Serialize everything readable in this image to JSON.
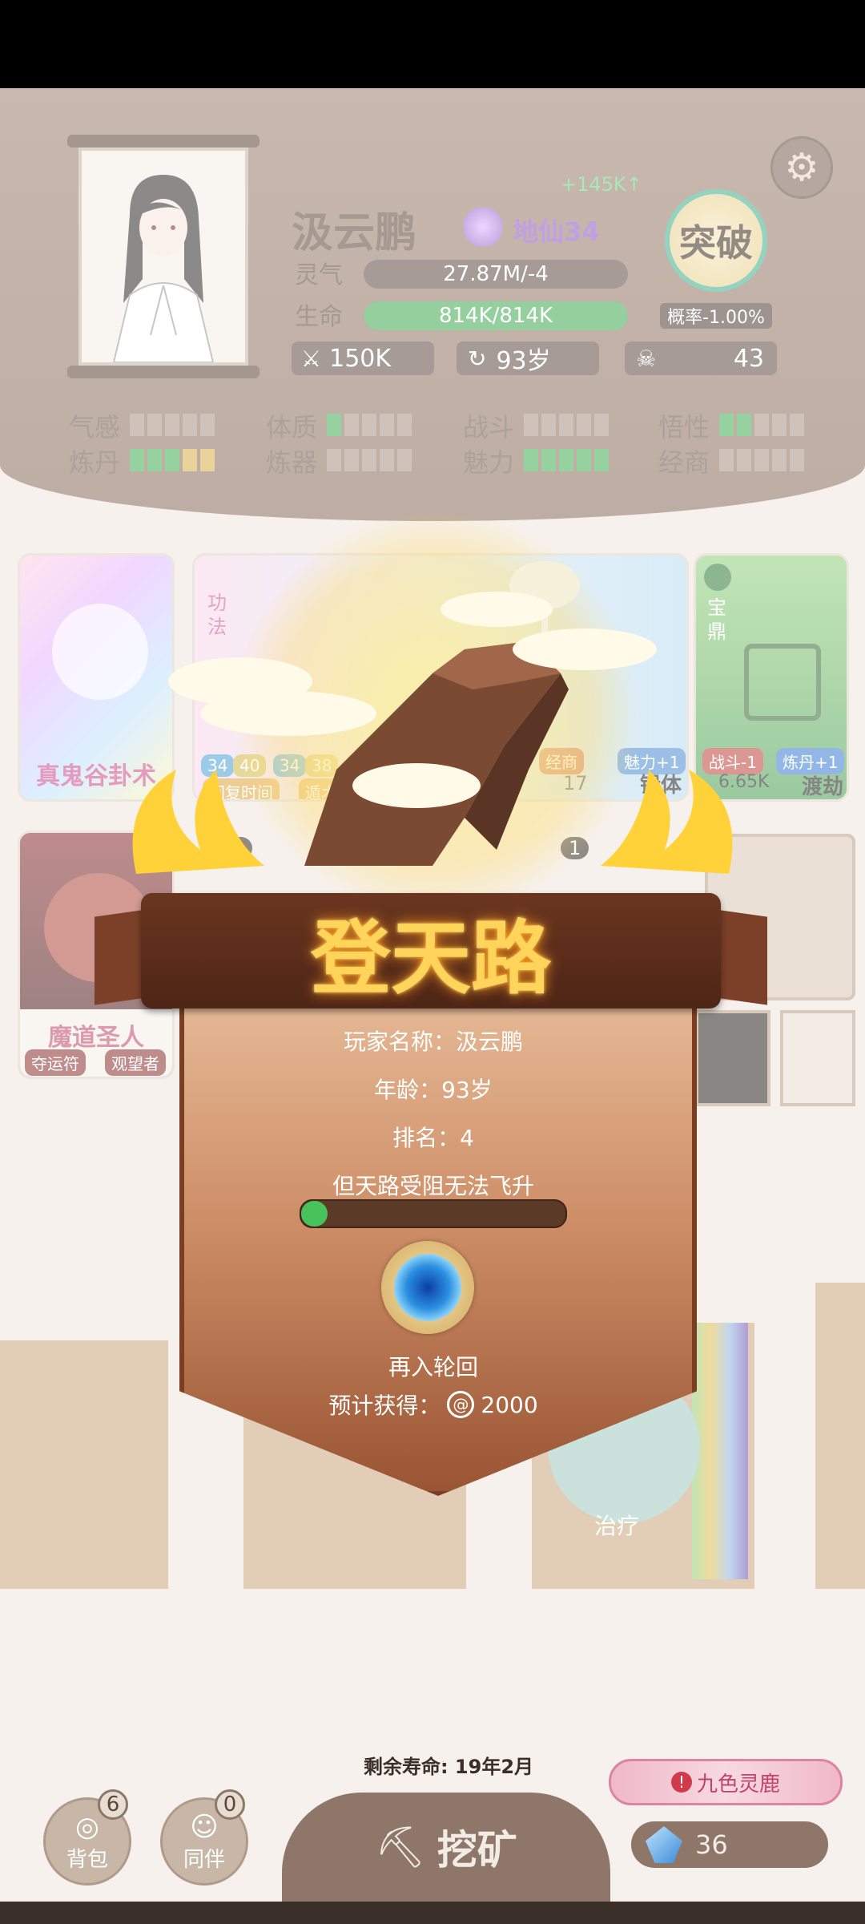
{
  "player": {
    "name": "汲云鹏",
    "realm": "地仙34",
    "exp_gain": "+145K",
    "lingqi_label": "灵气",
    "lingqi_value": "27.87M/-4",
    "hp_label": "生命",
    "hp_value": "814K/814K",
    "hp_ratio": 1.0,
    "power": "150K",
    "age": "93岁",
    "kills": "43"
  },
  "breakthrough": {
    "label": "突破",
    "rate": "概率-1.00%"
  },
  "attributes": [
    {
      "label": "气感",
      "level": 0
    },
    {
      "label": "体质",
      "level": 1
    },
    {
      "label": "战斗",
      "level": 0
    },
    {
      "label": "悟性",
      "level": 2
    },
    {
      "label": "炼丹",
      "level": 3,
      "extra_gold": 1
    },
    {
      "label": "炼器",
      "level": 0
    },
    {
      "label": "魅力",
      "level": 5
    },
    {
      "label": "经商",
      "level": 0
    }
  ],
  "cards": {
    "c1_title": "真鬼谷卦术",
    "c2_tag": "功法",
    "c2_a": "回复时间",
    "c2_b": "遁术",
    "c2_n1": "34",
    "c2_n2": "40",
    "c2_n3": "34",
    "c2_n4": "38",
    "c3_tag1": "经商",
    "c3_tag2": "魅力+1",
    "c3_n": "17",
    "c3_title": "锻体",
    "c4_tag": "宝鼎",
    "c4_t1": "战斗-1",
    "c4_t2": "炼丹+1",
    "c4_val": "6.65K",
    "c4_title": "渡劫",
    "c5_title": "魔道圣人",
    "c5_t1": "夺运符",
    "c5_t2": "观望者",
    "c6_n1": "1",
    "c6_n2": "1",
    "c7_title": "治疗"
  },
  "modal": {
    "title": "登天路",
    "player_name_line": "玩家名称：汲云鹏",
    "age_line": "年龄：93岁",
    "rank_line": "排名：4",
    "blocked_line": "但天路受阻无法飞升",
    "progress": 0.1,
    "rebirth_label": "再入轮回",
    "expected_label": "预计获得：",
    "expected_value": "2000"
  },
  "bottom": {
    "lifespan": "剩余寿命: 19年2月",
    "bag_label": "背包",
    "bag_badge": "6",
    "partner_label": "同伴",
    "partner_badge": "0",
    "mine_label": "挖矿",
    "event_label": "九色灵鹿",
    "gems": "36"
  },
  "colors": {
    "accent_green": "#48c25a",
    "banner_gold": "#ffd45a",
    "realm_purple": "#7c4bb8"
  }
}
